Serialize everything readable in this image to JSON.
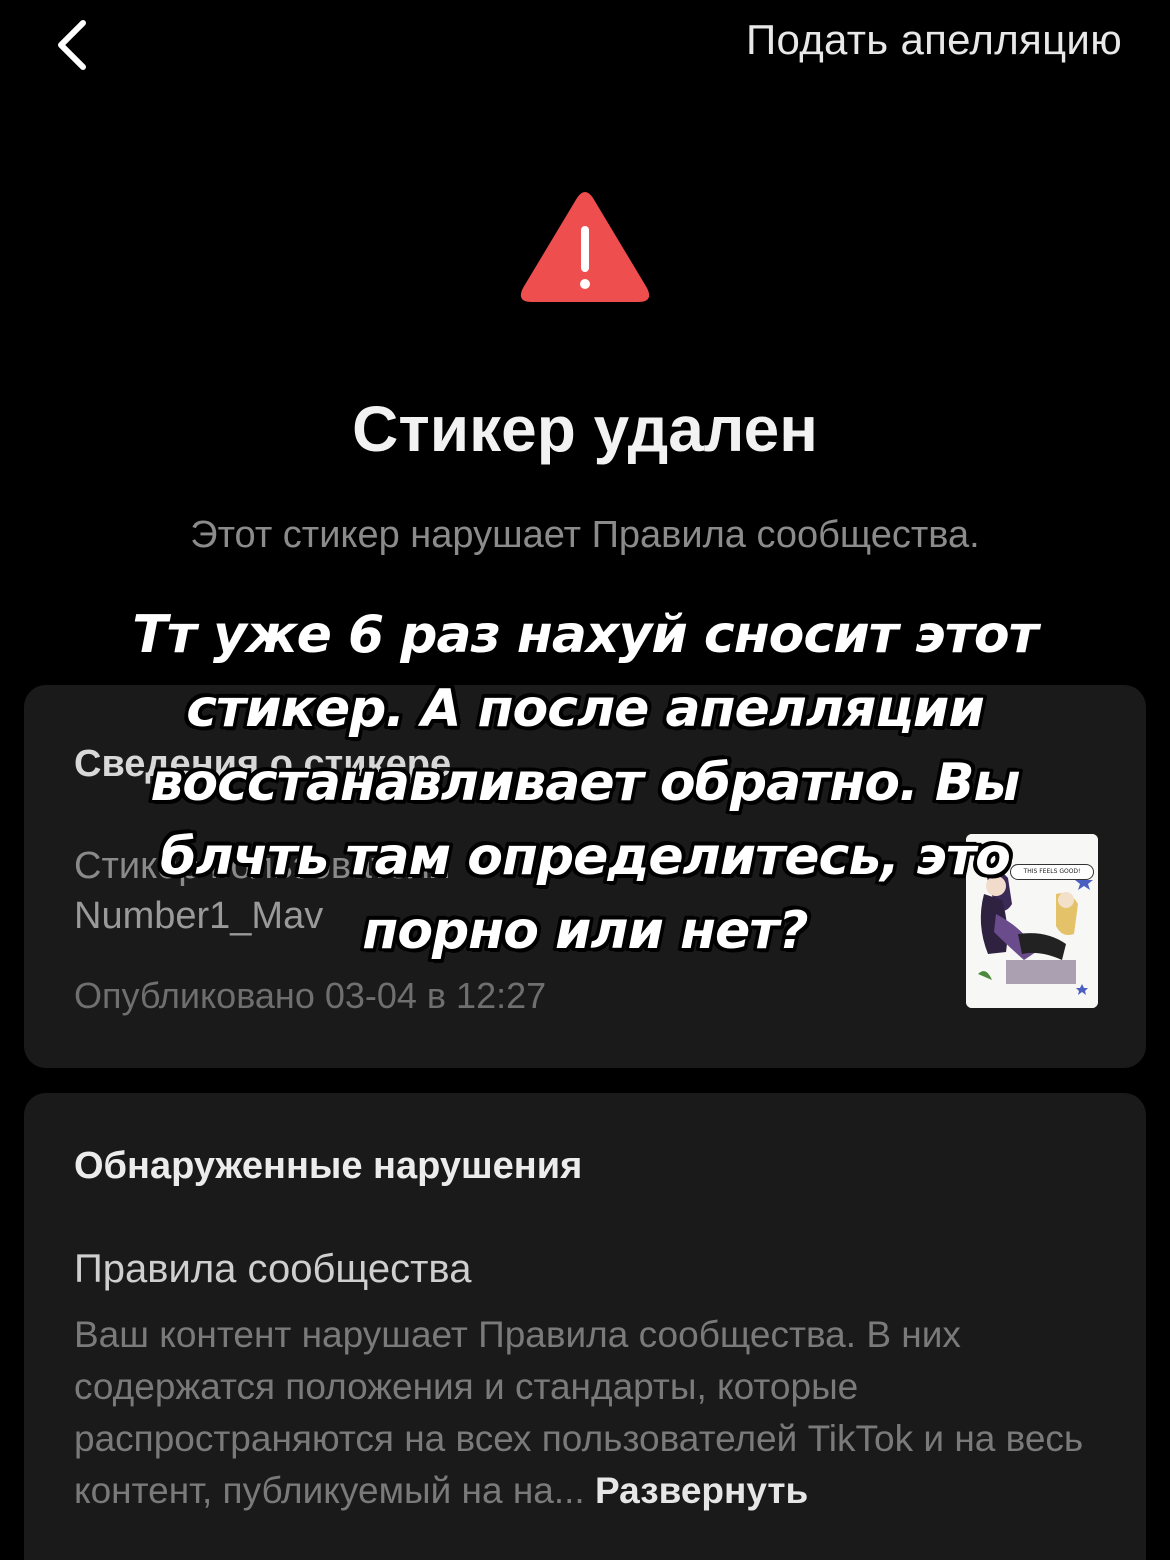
{
  "header": {
    "back_icon": "chevron-left-icon",
    "appeal_label": "Подать апелляцию"
  },
  "status": {
    "icon": "warning-triangle-icon",
    "icon_color": "#ef4e4e",
    "title": "Стикер удален",
    "subtitle": "Этот стикер нарушает Правила сообщества."
  },
  "sticker_info": {
    "heading": "Сведения о стикере",
    "type_label": "Стикер пользователя",
    "username": "Number1_Mav",
    "published": "Опубликовано 03-04 в 12:27",
    "thumbnail_caption": "THIS FEELS GOOD!"
  },
  "violations": {
    "heading": "Обнаруженные нарушения",
    "rule_title": "Правила сообщества",
    "rule_description": "Ваш контент нарушает Правила сообщества. В них содержатся положения и стандарты, которые распространяются на всех пользователей TikTok и на весь контент, публикуемый на на...",
    "expand_label": "Развернуть"
  },
  "overlay_caption": "Тт уже 6 раз нахуй сносит этот стикер. А после апелляции восстанавливает обратно. Вы блчть там определитесь, это порно или нет?"
}
